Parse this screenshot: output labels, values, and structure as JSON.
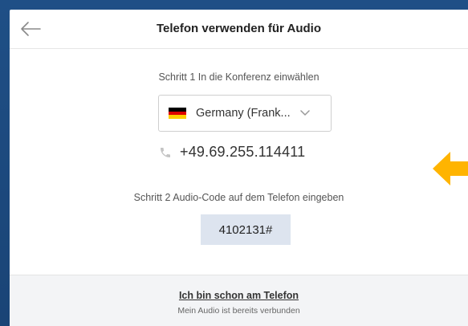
{
  "header": {
    "title": "Telefon verwenden für Audio",
    "back_icon": "back-arrow-icon"
  },
  "step1": {
    "label": "Schritt 1 In die Konferenz einwählen",
    "country": "Germany (Frank...",
    "flag": "germany-flag",
    "phone_icon": "phone-icon",
    "phone_number": "+49.69.255.114411"
  },
  "step2": {
    "label": "Schritt 2 Audio-Code auf dem Telefon eingeben",
    "code": "4102131#"
  },
  "footer": {
    "link_label": "Ich bin schon am Telefon",
    "subtext": "Mein Audio ist bereits verbunden"
  },
  "colors": {
    "background": "#1f4f86",
    "code_box": "#dde4ef",
    "highlight_arrow": "#ffb400",
    "footer_bg": "#f3f4f6"
  }
}
